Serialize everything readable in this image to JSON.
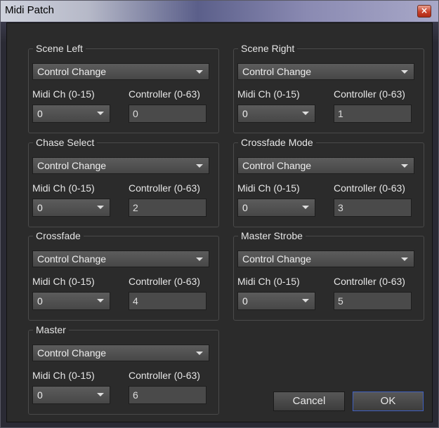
{
  "window": {
    "title": "Midi Patch",
    "close_label": "×"
  },
  "common": {
    "midi_ch_label": "Midi Ch (0-15)",
    "controller_label": "Controller (0-63)"
  },
  "groups": [
    {
      "name": "Scene Left",
      "type": "Control Change",
      "midi_ch": "0",
      "controller": "0"
    },
    {
      "name": "Scene Right",
      "type": "Control Change",
      "midi_ch": "0",
      "controller": "1"
    },
    {
      "name": "Chase Select",
      "type": "Control Change",
      "midi_ch": "0",
      "controller": "2"
    },
    {
      "name": "Crossfade Mode",
      "type": "Control Change",
      "midi_ch": "0",
      "controller": "3"
    },
    {
      "name": "Crossfade",
      "type": "Control Change",
      "midi_ch": "0",
      "controller": "4"
    },
    {
      "name": "Master Strobe",
      "type": "Control Change",
      "midi_ch": "0",
      "controller": "5"
    },
    {
      "name": "Master",
      "type": "Control Change",
      "midi_ch": "0",
      "controller": "6"
    }
  ],
  "buttons": {
    "cancel_label": "Cancel",
    "ok_label": "OK"
  }
}
